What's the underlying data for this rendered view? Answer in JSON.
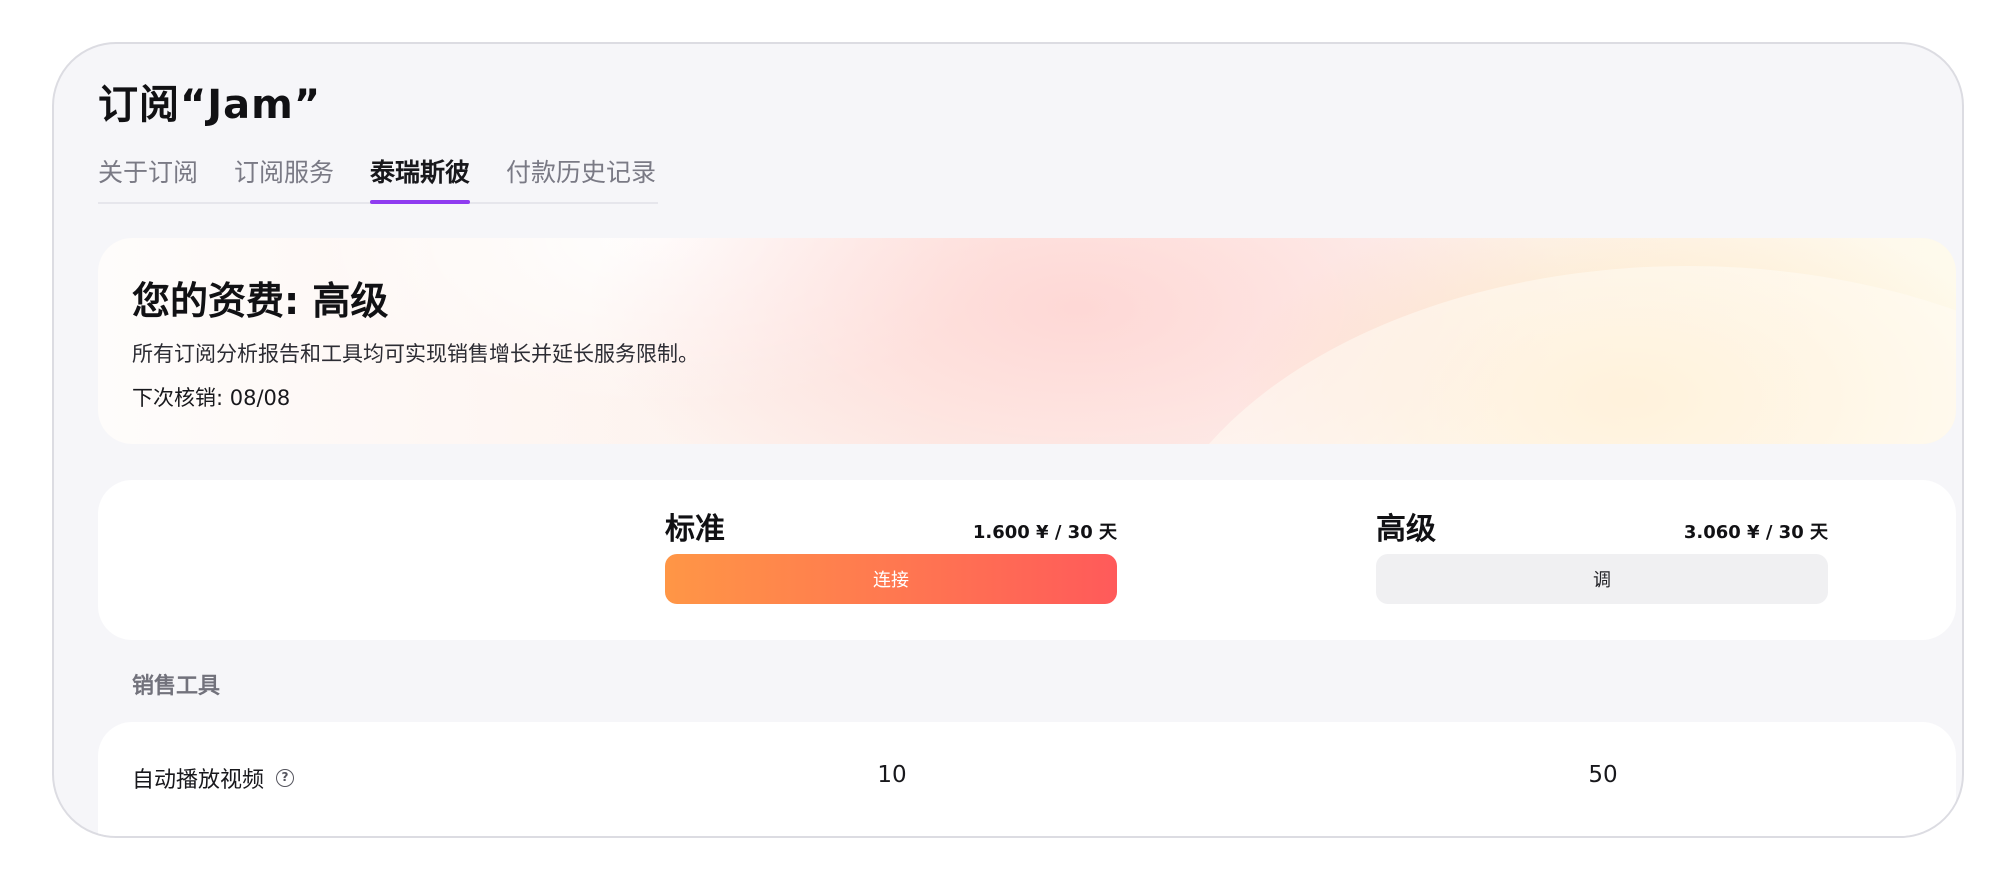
{
  "page": {
    "title": "订阅“Jam”"
  },
  "tabs": [
    {
      "label": "关于订阅",
      "active": false
    },
    {
      "label": "订阅服务",
      "active": false
    },
    {
      "label": "泰瑞斯彼",
      "active": true
    },
    {
      "label": "付款历史记录",
      "active": false
    }
  ],
  "banner": {
    "title": "您的资费: 高级",
    "description": "所有订阅分析报告和工具均可实现销售增长并延长服务限制。",
    "next_charge": "下次核销: 08/08"
  },
  "plans": [
    {
      "name": "标准",
      "price": "1.600 ¥ / 30 天",
      "button_label": "连接"
    },
    {
      "name": "高级",
      "price": "3.060 ¥ / 30 天",
      "button_label": "调"
    }
  ],
  "sections": [
    {
      "label": "销售工具",
      "features": [
        {
          "name": "自动播放视频",
          "help_icon": "question-circle-icon",
          "values": [
            "10",
            "50"
          ]
        }
      ]
    }
  ],
  "colors": {
    "accent": "#8f3cf0",
    "primary_button_start": "#ff9646",
    "primary_button_end": "#ff5a5a",
    "window_background": "#f6f6f9"
  }
}
